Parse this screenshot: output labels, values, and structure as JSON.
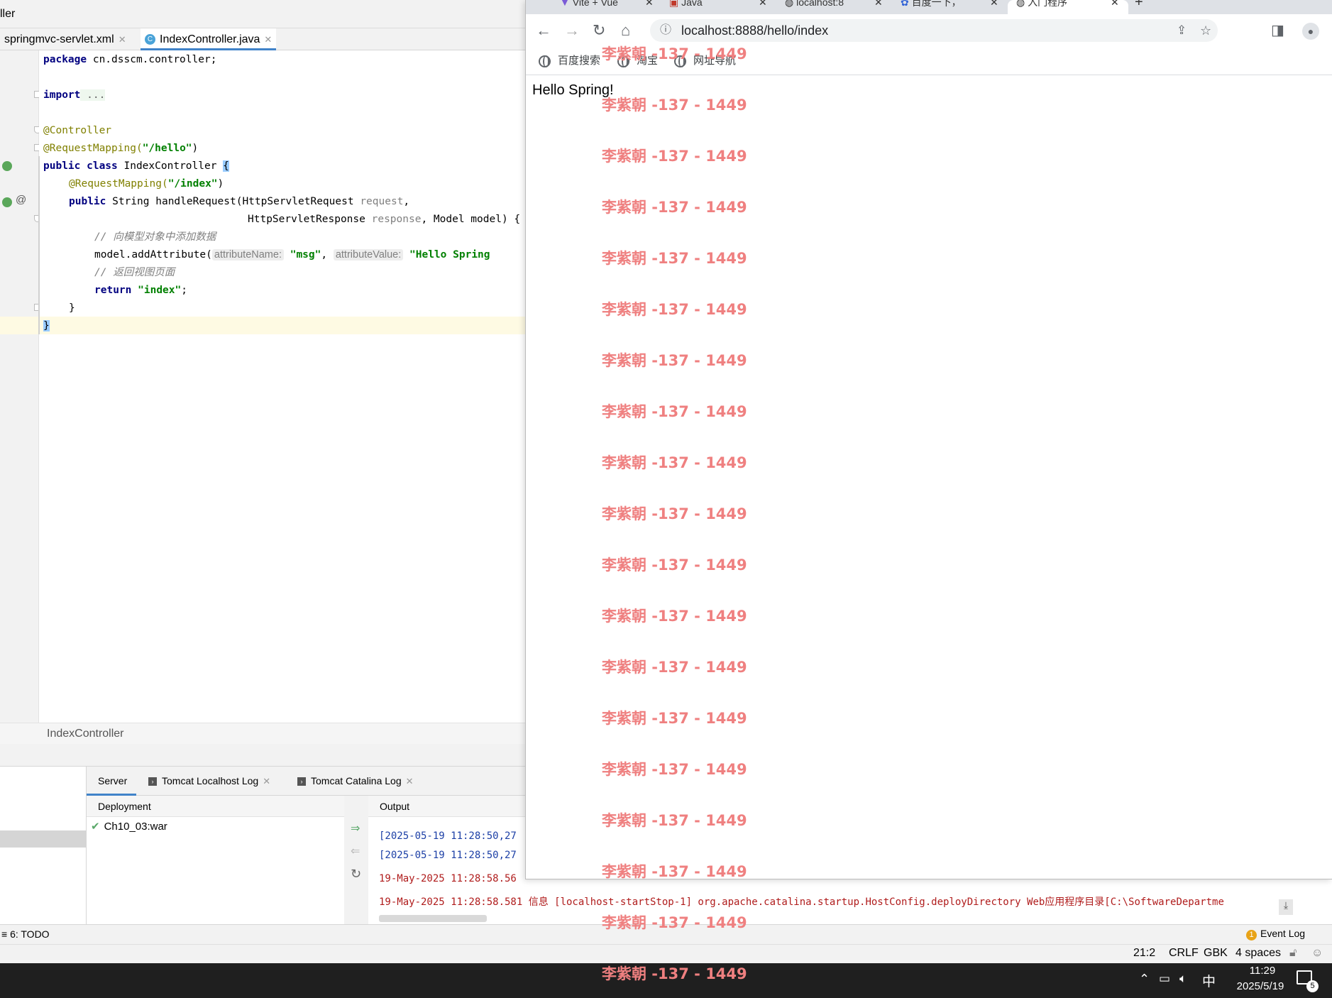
{
  "ide": {
    "title": "ller",
    "tabs": [
      {
        "label": "springmvc-servlet.xml",
        "close": "✕"
      },
      {
        "label": "IndexController.java",
        "close": "✕",
        "icon": "C"
      }
    ],
    "code": {
      "l1_kw": "package",
      "l1_rest": " cn.dsscm.controller;",
      "l3_kw": "import",
      "l3_rest": " ...",
      "l5": "@Controller",
      "l6_ann": "@RequestMapping(",
      "l6_str": "\"/hello\"",
      "l6_end": ")",
      "l7_kw": "public class",
      "l7_rest": " IndexController ",
      "l7_brace": "{",
      "l8_ann": "@RequestMapping(",
      "l8_str": "\"/index\"",
      "l8_end": ")",
      "l9_kw": "public",
      "l9_rest": " String handleRequest(HttpServletRequest ",
      "l9_par": "request",
      "l9_end": ",",
      "l10_rest": "HttpServletResponse ",
      "l10_par": "response",
      "l10_end": ", Model model) {",
      "l11": "// 向模型对象中添加数据",
      "l12_a": "model.addAttribute(",
      "l12_hint1": "attributeName:",
      "l12_str1": "\"msg\"",
      "l12_comma": ", ",
      "l12_hint2": "attributeValue:",
      "l12_str2": "\"Hello Spring",
      "l13": "// 返回视图页面",
      "l14_kw": "return",
      "l14_str": "\"index\"",
      "l14_end": ";",
      "l15": "}",
      "l16": "}"
    },
    "breadcrumb": "IndexController",
    "services": {
      "tabs": [
        "Server",
        "Tomcat Localhost Log",
        "Tomcat Catalina Log"
      ],
      "deployment_header": "Deployment",
      "output_header": "Output",
      "deployment_item": "Ch10_03:war",
      "log_lines": [
        {
          "text": "[2025-05-19 11:28:50,27",
          "color": "#1c3fa6"
        },
        {
          "text": "[2025-05-19 11:28:50,27",
          "color": "#1c3fa6"
        },
        {
          "text": "19-May-2025 11:28:58.56",
          "color": "#b01c1c"
        },
        {
          "text": "19-May-2025 11:28:58.581 信息 [localhost-startStop-1] org.apache.catalina.startup.HostConfig.deployDirectory Web应用程序目录[C:\\SoftwareDepartme",
          "color": "#b01c1c"
        }
      ]
    },
    "status_todo": "6: TODO",
    "event_log": "Event Log",
    "event_badge": "1",
    "status_items": [
      "21:2",
      "CRLF",
      "GBK",
      "4 spaces"
    ]
  },
  "browser": {
    "tabs": [
      "Vite + Vue",
      "Java",
      "localhost:8",
      "百度一下，",
      "入门程序"
    ],
    "new_tab": "+",
    "url": "localhost:8888/hello/index",
    "bookmarks": [
      "百度搜索",
      "淘宝",
      "网址导航"
    ],
    "page_text": "Hello Spring!"
  },
  "watermark": "李紫朝 -137 - 1449",
  "taskbar": {
    "time": "11:29",
    "date": "2025/5/19",
    "ime": "中",
    "notify_count": "5"
  }
}
